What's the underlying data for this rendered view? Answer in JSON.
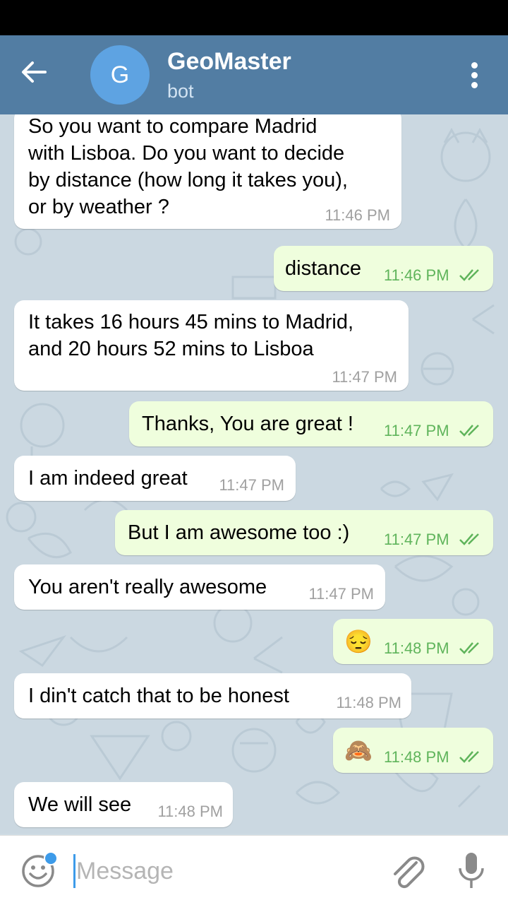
{
  "header": {
    "avatar_letter": "G",
    "title": "GeoMaster",
    "subtitle": "bot"
  },
  "messages": [
    {
      "direction": "in",
      "text": "So you want to compare Madrid\nwith Lisboa. Do you want to decide\nby distance (how long it takes you),\nor by weather ?",
      "time": "11:46 PM"
    },
    {
      "direction": "out",
      "text": "distance",
      "time": "11:46 PM",
      "read": true
    },
    {
      "direction": "in",
      "text": "It takes 16 hours 45 mins to Madrid,\nand 20 hours 52 mins to Lisboa",
      "time": "11:47 PM"
    },
    {
      "direction": "out",
      "text": "Thanks, You are great !",
      "time": "11:47 PM",
      "read": true
    },
    {
      "direction": "in",
      "text": "I am indeed great",
      "time": "11:47 PM"
    },
    {
      "direction": "out",
      "text": "But I am awesome too :)",
      "time": "11:47 PM",
      "read": true
    },
    {
      "direction": "in",
      "text": "You aren't really awesome",
      "time": "11:47 PM"
    },
    {
      "direction": "out",
      "text": "😔",
      "time": "11:48 PM",
      "read": true
    },
    {
      "direction": "in",
      "text": "I din't catch that to be honest",
      "time": "11:48 PM"
    },
    {
      "direction": "out",
      "text": "🙈",
      "time": "11:48 PM",
      "read": true
    },
    {
      "direction": "in",
      "text": "We will see",
      "time": "11:48 PM"
    }
  ],
  "input": {
    "placeholder": "Message",
    "value": ""
  },
  "colors": {
    "header": "#527da3",
    "incoming_bubble": "#ffffff",
    "outgoing_bubble": "#effedd",
    "outgoing_time": "#5fb45b",
    "accent": "#3d9be9"
  },
  "icons": [
    "back-arrow-icon",
    "menu-dots-icon",
    "double-check-icon",
    "smile-icon",
    "attach-icon",
    "mic-icon"
  ]
}
